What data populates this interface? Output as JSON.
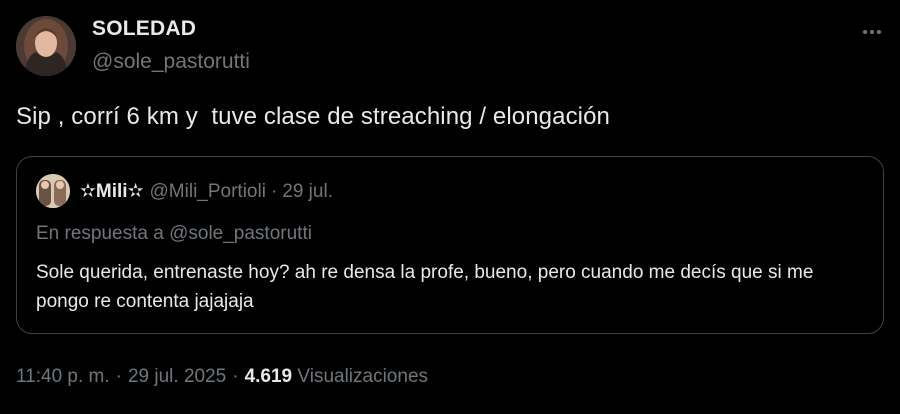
{
  "author": {
    "display_name": "SOLEDAD",
    "handle": "@sole_pastorutti",
    "avatar_icon": "profile-photo-avatar"
  },
  "more_menu": {
    "icon": "more-horizontal-icon"
  },
  "tweet": {
    "text": "Sip , corrí 6 km y  tuve clase de streaching / elongación"
  },
  "quoted_tweet": {
    "display_name": "✫Mili✫",
    "handle": "@Mili_Portioli",
    "separator": "·",
    "date": "29 jul.",
    "reply_prefix": "En respuesta a",
    "reply_to": "@sole_pastorutti",
    "text": "Sole querida, entrenaste hoy? ah re densa la profe, bueno, pero cuando me decís que si me pongo re contenta jajajaja"
  },
  "meta": {
    "time": "11:40 p. m.",
    "separator": "·",
    "date": "29 jul. 2025",
    "views_count": "4.619",
    "views_label": "Visualizaciones"
  },
  "colors": {
    "background": "#000000",
    "primary_text": "#e7e9ea",
    "secondary_text": "#71767b",
    "border": "#3e4144"
  }
}
